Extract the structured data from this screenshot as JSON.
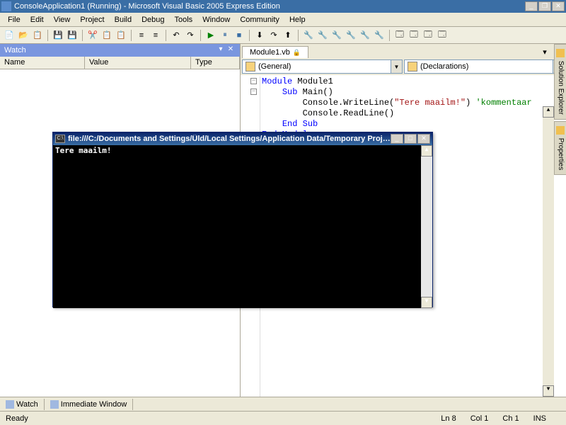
{
  "window": {
    "title": "ConsoleApplication1 (Running) - Microsoft Visual Basic 2005 Express Edition",
    "minimize": "_",
    "restore": "❐",
    "close": "✕"
  },
  "menu": {
    "file": "File",
    "edit": "Edit",
    "view": "View",
    "project": "Project",
    "build": "Build",
    "debug": "Debug",
    "tools": "Tools",
    "window": "Window",
    "community": "Community",
    "help": "Help"
  },
  "watch": {
    "title": "Watch",
    "col_name": "Name",
    "col_value": "Value",
    "col_type": "Type"
  },
  "editor": {
    "tab": "Module1.vb",
    "dd_left": "(General)",
    "dd_right": "(Declarations)",
    "line1_kw1": "Module",
    "line1_id": " Module1",
    "line2_kw": "Sub",
    "line2_id": " Main()",
    "line3_call": "        Console.WriteLine(",
    "line3_str": "\"Tere maailm!\"",
    "line3_end": ") ",
    "line3_cmt": "'kommentaar",
    "line4": "        Console.ReadLine()",
    "line5_kw": "End Sub",
    "line6_kw": "End Module"
  },
  "side_tabs": {
    "solution": "Solution Explorer",
    "properties": "Properties"
  },
  "bottom_tabs": {
    "watch": "Watch",
    "immediate": "Immediate Window"
  },
  "status": {
    "ready": "Ready",
    "ln": "Ln 8",
    "col": "Col 1",
    "ch": "Ch 1",
    "ins": "INS"
  },
  "console": {
    "title": "file:///C:/Documents and Settings/Üld/Local Settings/Application Data/Temporary Projects/ConsoleA...",
    "icon_text": "C:\\",
    "output": "Tere maailm!"
  }
}
